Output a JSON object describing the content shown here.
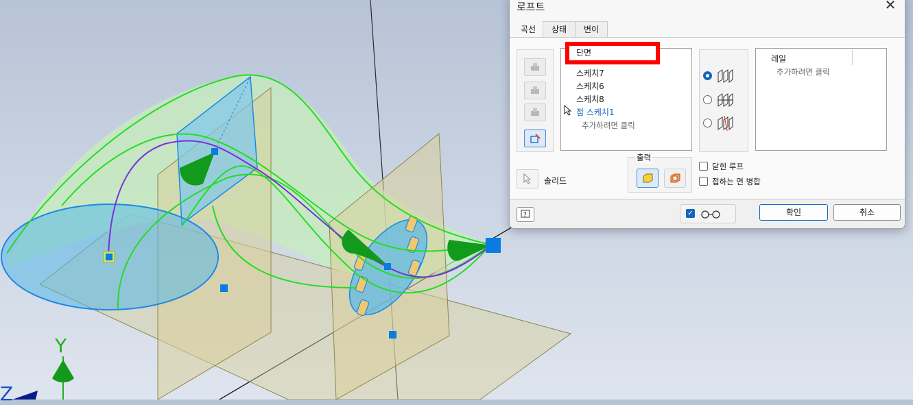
{
  "dialog": {
    "title": "로프트",
    "close_icon": "close-icon",
    "tabs": [
      {
        "label": "곡선"
      },
      {
        "label": "상태"
      },
      {
        "label": "변이"
      }
    ],
    "sections": {
      "header": "단면",
      "items": [
        "스케치7",
        "스케치6",
        "스케치8"
      ],
      "active_item": "점 스케치1",
      "hint": "추가하려면 클릭"
    },
    "rails": {
      "header": "레일",
      "hint": "추가하려면 클릭"
    },
    "solid_label": "솔리드",
    "output": {
      "label": "출력"
    },
    "options": {
      "closed_loop": "닫힌 루프",
      "merge_tangent": "접하는 면 병합"
    },
    "footer": {
      "ok": "확인",
      "cancel": "취소"
    }
  },
  "viewport": {
    "axis_y": "Y",
    "axis_z": "Z",
    "colors": {
      "loft_green": "#22dd22",
      "loft_fill": "#c6f0b8",
      "plane": "#d8cf9a",
      "section_blue": "#58b8e8",
      "rail_purple": "#7b2fd8",
      "point_blue": "#0a7be0"
    }
  }
}
